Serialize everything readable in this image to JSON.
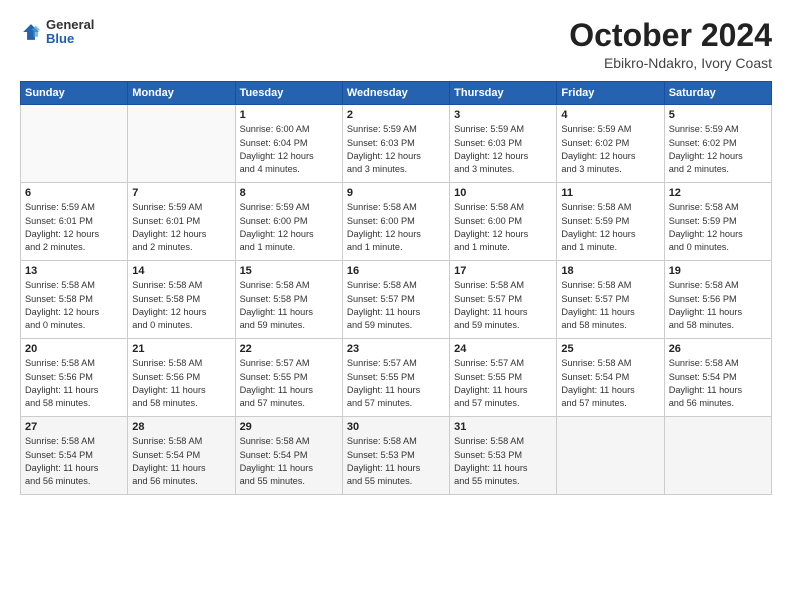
{
  "logo": {
    "general": "General",
    "blue": "Blue"
  },
  "title": "October 2024",
  "location": "Ebikro-Ndakro, Ivory Coast",
  "weekdays": [
    "Sunday",
    "Monday",
    "Tuesday",
    "Wednesday",
    "Thursday",
    "Friday",
    "Saturday"
  ],
  "weeks": [
    [
      {
        "day": "",
        "info": ""
      },
      {
        "day": "",
        "info": ""
      },
      {
        "day": "1",
        "info": "Sunrise: 6:00 AM\nSunset: 6:04 PM\nDaylight: 12 hours\nand 4 minutes."
      },
      {
        "day": "2",
        "info": "Sunrise: 5:59 AM\nSunset: 6:03 PM\nDaylight: 12 hours\nand 3 minutes."
      },
      {
        "day": "3",
        "info": "Sunrise: 5:59 AM\nSunset: 6:03 PM\nDaylight: 12 hours\nand 3 minutes."
      },
      {
        "day": "4",
        "info": "Sunrise: 5:59 AM\nSunset: 6:02 PM\nDaylight: 12 hours\nand 3 minutes."
      },
      {
        "day": "5",
        "info": "Sunrise: 5:59 AM\nSunset: 6:02 PM\nDaylight: 12 hours\nand 2 minutes."
      }
    ],
    [
      {
        "day": "6",
        "info": "Sunrise: 5:59 AM\nSunset: 6:01 PM\nDaylight: 12 hours\nand 2 minutes."
      },
      {
        "day": "7",
        "info": "Sunrise: 5:59 AM\nSunset: 6:01 PM\nDaylight: 12 hours\nand 2 minutes."
      },
      {
        "day": "8",
        "info": "Sunrise: 5:59 AM\nSunset: 6:00 PM\nDaylight: 12 hours\nand 1 minute."
      },
      {
        "day": "9",
        "info": "Sunrise: 5:58 AM\nSunset: 6:00 PM\nDaylight: 12 hours\nand 1 minute."
      },
      {
        "day": "10",
        "info": "Sunrise: 5:58 AM\nSunset: 6:00 PM\nDaylight: 12 hours\nand 1 minute."
      },
      {
        "day": "11",
        "info": "Sunrise: 5:58 AM\nSunset: 5:59 PM\nDaylight: 12 hours\nand 1 minute."
      },
      {
        "day": "12",
        "info": "Sunrise: 5:58 AM\nSunset: 5:59 PM\nDaylight: 12 hours\nand 0 minutes."
      }
    ],
    [
      {
        "day": "13",
        "info": "Sunrise: 5:58 AM\nSunset: 5:58 PM\nDaylight: 12 hours\nand 0 minutes."
      },
      {
        "day": "14",
        "info": "Sunrise: 5:58 AM\nSunset: 5:58 PM\nDaylight: 12 hours\nand 0 minutes."
      },
      {
        "day": "15",
        "info": "Sunrise: 5:58 AM\nSunset: 5:58 PM\nDaylight: 11 hours\nand 59 minutes."
      },
      {
        "day": "16",
        "info": "Sunrise: 5:58 AM\nSunset: 5:57 PM\nDaylight: 11 hours\nand 59 minutes."
      },
      {
        "day": "17",
        "info": "Sunrise: 5:58 AM\nSunset: 5:57 PM\nDaylight: 11 hours\nand 59 minutes."
      },
      {
        "day": "18",
        "info": "Sunrise: 5:58 AM\nSunset: 5:57 PM\nDaylight: 11 hours\nand 58 minutes."
      },
      {
        "day": "19",
        "info": "Sunrise: 5:58 AM\nSunset: 5:56 PM\nDaylight: 11 hours\nand 58 minutes."
      }
    ],
    [
      {
        "day": "20",
        "info": "Sunrise: 5:58 AM\nSunset: 5:56 PM\nDaylight: 11 hours\nand 58 minutes."
      },
      {
        "day": "21",
        "info": "Sunrise: 5:58 AM\nSunset: 5:56 PM\nDaylight: 11 hours\nand 58 minutes."
      },
      {
        "day": "22",
        "info": "Sunrise: 5:57 AM\nSunset: 5:55 PM\nDaylight: 11 hours\nand 57 minutes."
      },
      {
        "day": "23",
        "info": "Sunrise: 5:57 AM\nSunset: 5:55 PM\nDaylight: 11 hours\nand 57 minutes."
      },
      {
        "day": "24",
        "info": "Sunrise: 5:57 AM\nSunset: 5:55 PM\nDaylight: 11 hours\nand 57 minutes."
      },
      {
        "day": "25",
        "info": "Sunrise: 5:58 AM\nSunset: 5:54 PM\nDaylight: 11 hours\nand 57 minutes."
      },
      {
        "day": "26",
        "info": "Sunrise: 5:58 AM\nSunset: 5:54 PM\nDaylight: 11 hours\nand 56 minutes."
      }
    ],
    [
      {
        "day": "27",
        "info": "Sunrise: 5:58 AM\nSunset: 5:54 PM\nDaylight: 11 hours\nand 56 minutes."
      },
      {
        "day": "28",
        "info": "Sunrise: 5:58 AM\nSunset: 5:54 PM\nDaylight: 11 hours\nand 56 minutes."
      },
      {
        "day": "29",
        "info": "Sunrise: 5:58 AM\nSunset: 5:54 PM\nDaylight: 11 hours\nand 55 minutes."
      },
      {
        "day": "30",
        "info": "Sunrise: 5:58 AM\nSunset: 5:53 PM\nDaylight: 11 hours\nand 55 minutes."
      },
      {
        "day": "31",
        "info": "Sunrise: 5:58 AM\nSunset: 5:53 PM\nDaylight: 11 hours\nand 55 minutes."
      },
      {
        "day": "",
        "info": ""
      },
      {
        "day": "",
        "info": ""
      }
    ]
  ]
}
